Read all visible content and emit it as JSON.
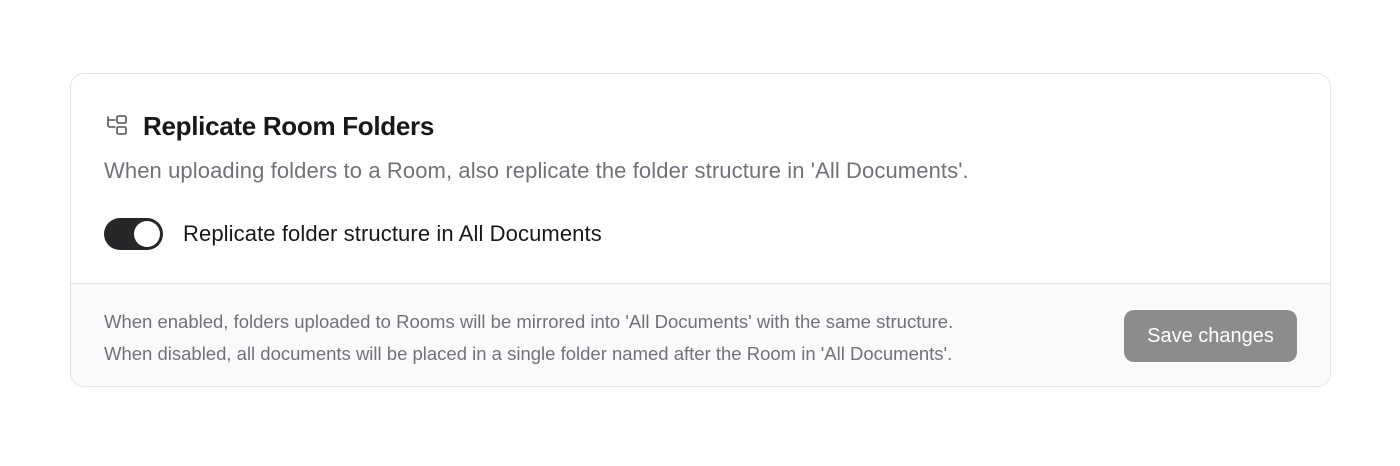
{
  "section": {
    "icon": "folder-tree-icon",
    "title": "Replicate Room Folders",
    "description": "When uploading folders to a Room, also replicate the folder structure in 'All Documents'."
  },
  "toggle": {
    "label": "Replicate folder structure in All Documents",
    "enabled": true
  },
  "footer": {
    "note_enabled": "When enabled, folders uploaded to Rooms will be mirrored into 'All Documents' with the same structure.",
    "note_disabled": "When disabled, all documents will be placed in a single folder named after the Room in 'All Documents'.",
    "save_label": "Save changes"
  },
  "colors": {
    "toggle_on": "#27272a",
    "save_button_disabled": "#8c8c8c",
    "muted_text": "#71717a",
    "border": "#e4e4e7"
  }
}
